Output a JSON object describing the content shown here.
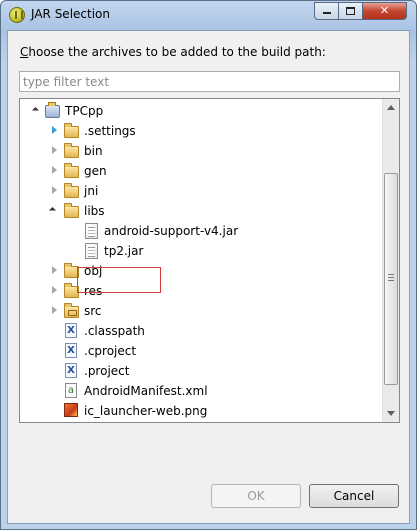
{
  "window": {
    "title": "JAR Selection"
  },
  "dialog": {
    "prompt_prefix": "C",
    "prompt_rest": "hoose the archives to be added to the build path:",
    "filter_placeholder": "type filter text",
    "filter_value": ""
  },
  "tree": {
    "items": [
      {
        "label": "TPCpp",
        "icon": "project-icon",
        "expander": "expanded"
      },
      {
        "label": ".settings",
        "icon": "folder-icon",
        "expander": "collapsed-hover"
      },
      {
        "label": "bin",
        "icon": "folder-icon",
        "expander": "collapsed"
      },
      {
        "label": "gen",
        "icon": "folder-icon",
        "expander": "collapsed"
      },
      {
        "label": "jni",
        "icon": "folder-icon",
        "expander": "collapsed"
      },
      {
        "label": "libs",
        "icon": "folder-icon",
        "expander": "expanded"
      },
      {
        "label": "android-support-v4.jar",
        "icon": "jar-icon",
        "expander": "none"
      },
      {
        "label": "tp2.jar",
        "icon": "jar-icon",
        "expander": "none",
        "highlighted": true
      },
      {
        "label": "obj",
        "icon": "folder-icon",
        "expander": "collapsed"
      },
      {
        "label": "res",
        "icon": "folder-icon",
        "expander": "collapsed"
      },
      {
        "label": "src",
        "icon": "package-folder-icon",
        "expander": "collapsed"
      },
      {
        "label": ".classpath",
        "icon": "xml-file-icon",
        "expander": "none"
      },
      {
        "label": ".cproject",
        "icon": "xml-file-icon",
        "expander": "none"
      },
      {
        "label": ".project",
        "icon": "xml-file-icon",
        "expander": "none"
      },
      {
        "label": "AndroidManifest.xml",
        "icon": "android-manifest-icon",
        "expander": "none"
      },
      {
        "label": "ic_launcher-web.png",
        "icon": "png-file-icon",
        "expander": "none"
      }
    ]
  },
  "buttons": {
    "ok": "OK",
    "cancel": "Cancel",
    "ok_enabled": false
  },
  "colors": {
    "highlight_border": "#d33b3b",
    "title_bar": "#a9c3e3",
    "close_button": "#c6452f"
  }
}
